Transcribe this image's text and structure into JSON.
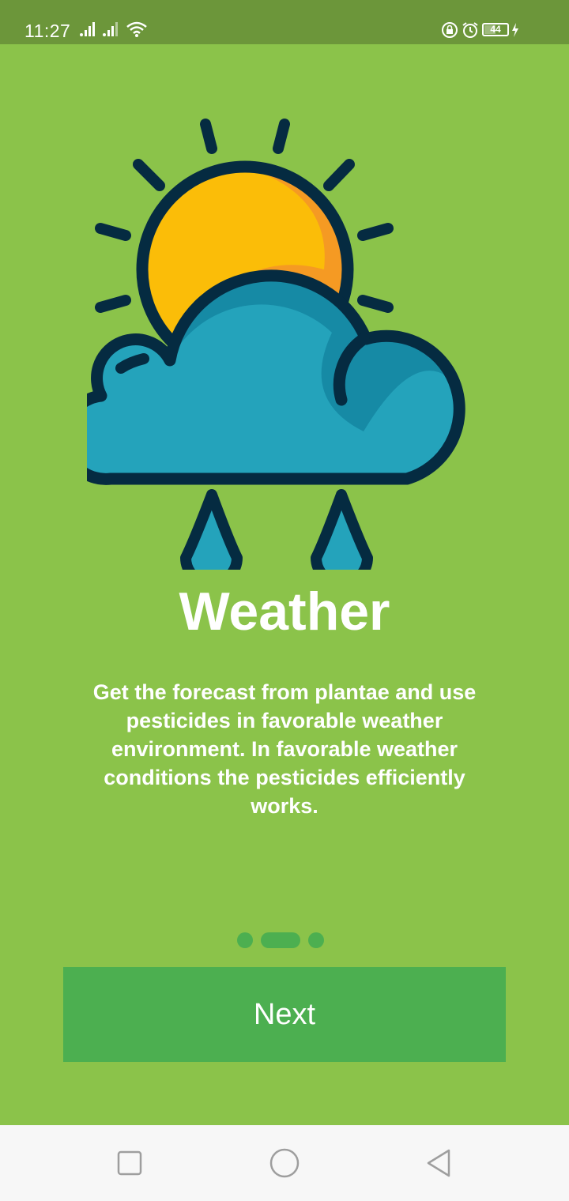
{
  "status_bar": {
    "time": "11:27",
    "battery_level": "44",
    "icons": [
      "signal-icon",
      "signal-icon",
      "wifi-icon",
      "lock-rotation-icon",
      "alarm-icon",
      "battery-icon",
      "charging-icon"
    ]
  },
  "onboarding": {
    "illustration_icon": "weather-sun-cloud-rain-icon",
    "title": "Weather",
    "description": "Get the forecast from plantae and use pesticides in favorable weather environment. In favorable weather conditions the pesticides efficiently works.",
    "page_indicator": {
      "total_pages": 3,
      "current_page": 2
    },
    "next_button_label": "Next"
  },
  "colors": {
    "background": "#8BC34A",
    "status_bar": "#6C963A",
    "accent": "#4CAF50",
    "sun": "#FBBD08",
    "sun_shade": "#F59A23",
    "cloud": "#24A3BB",
    "cloud_shade": "#168AA5",
    "outline": "#052B41"
  },
  "nav_bar": {
    "icons": [
      "recent-apps-icon",
      "home-icon",
      "back-icon"
    ]
  }
}
